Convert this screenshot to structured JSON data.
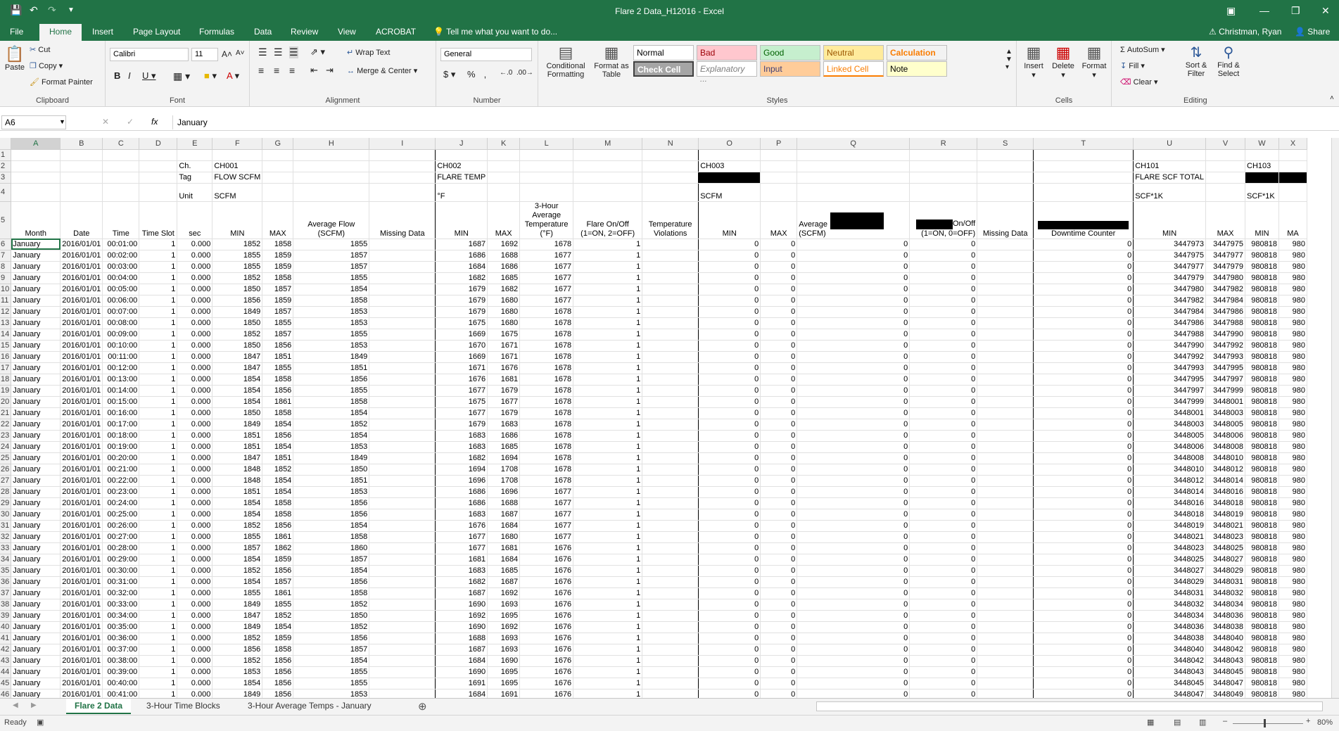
{
  "window": {
    "title": "Flare 2 Data_H12016 - Excel",
    "user": "Christman, Ryan",
    "share_label": "Share",
    "tell_me": "Tell me what you want to do..."
  },
  "tabs": [
    "File",
    "Home",
    "Insert",
    "Page Layout",
    "Formulas",
    "Data",
    "Review",
    "View",
    "ACROBAT"
  ],
  "ribbon": {
    "clipboard": {
      "paste": "Paste",
      "cut": "Cut",
      "copy": "Copy",
      "format_painter": "Format Painter",
      "label": "Clipboard"
    },
    "font": {
      "name": "Calibri",
      "size": "11",
      "label": "Font"
    },
    "alignment": {
      "wrap": "Wrap Text",
      "merge": "Merge & Center",
      "label": "Alignment"
    },
    "number": {
      "format": "General",
      "label": "Number"
    },
    "styles": {
      "conditional": "Conditional Formatting",
      "format_table": "Format as Table",
      "label": "Styles",
      "cells": [
        {
          "text": "Normal",
          "bg": "#ffffff",
          "fg": "#000000"
        },
        {
          "text": "Bad",
          "bg": "#ffc7ce",
          "fg": "#9c0006"
        },
        {
          "text": "Good",
          "bg": "#c6efce",
          "fg": "#006100"
        },
        {
          "text": "Neutral",
          "bg": "#ffeb9c",
          "fg": "#9c5700"
        },
        {
          "text": "Calculation",
          "bg": "#f2f2f2",
          "fg": "#fa7d00"
        },
        {
          "text": "Check Cell",
          "bg": "#a5a5a5",
          "fg": "#ffffff"
        },
        {
          "text": "Explanatory ...",
          "bg": "#ffffff",
          "fg": "#7f7f7f"
        },
        {
          "text": "Input",
          "bg": "#ffcc99",
          "fg": "#3f3f76"
        },
        {
          "text": "Linked Cell",
          "bg": "#ffffff",
          "fg": "#fa7d00"
        },
        {
          "text": "Note",
          "bg": "#ffffcc",
          "fg": "#000000"
        }
      ]
    },
    "cells": {
      "insert": "Insert",
      "delete": "Delete",
      "format": "Format",
      "label": "Cells"
    },
    "editing": {
      "autosum": "AutoSum",
      "fill": "Fill",
      "clear": "Clear",
      "sort": "Sort & Filter",
      "find": "Find & Select",
      "label": "Editing"
    }
  },
  "formula_bar": {
    "name_box": "A6",
    "value": "January"
  },
  "columns": [
    "A",
    "B",
    "C",
    "D",
    "E",
    "F",
    "G",
    "H",
    "I",
    "J",
    "K",
    "L",
    "M",
    "N",
    "O",
    "P",
    "Q",
    "R",
    "S",
    "T",
    "U",
    "V",
    "W",
    "X"
  ],
  "header_rows": {
    "r1": [],
    "r2": {
      "E": "Ch.",
      "F": "CH001",
      "J": "CH002",
      "O": "CH003",
      "U": "CH101",
      "W": "CH103"
    },
    "r3": {
      "E": "Tag",
      "F": "FLOW SCFM",
      "J": "FLARE TEMP",
      "U": "FLARE SCF TOTAL"
    },
    "r4": {
      "E": "Unit",
      "F": "SCFM",
      "J": "°F",
      "O": "SCFM",
      "U": "SCF*1K",
      "W": "SCF*1K"
    },
    "r5": {
      "A": "Month",
      "B": "Date",
      "C": "Time",
      "D": "Time Slot",
      "E": "sec",
      "F": "MIN",
      "G": "MAX",
      "H": "Average Flow (SCFM)",
      "I": "Missing Data",
      "J": "MIN",
      "K": "MAX",
      "L": "3-Hour Average Temperature (°F)",
      "M": "Flare On/Off (1=ON, 2=OFF)",
      "N": "Temperature Violations",
      "O": "MIN",
      "P": "MAX",
      "Q": "(SCFM)",
      "Q_left": "Average",
      "R": "On/Off (1=ON, 0=OFF)",
      "S": "Missing Data",
      "T": "Downtime Counter",
      "U": "MIN",
      "V": "MAX",
      "W": "MIN",
      "X": "MA"
    }
  },
  "data_rows": [
    [
      "January",
      "2016/01/01",
      "00:01:00",
      "1",
      "0.000",
      "1852",
      "1858",
      "1855",
      "",
      "1687",
      "1692",
      "1678",
      "1",
      "",
      "0",
      "0",
      "0",
      "0",
      "",
      "0",
      "3447973",
      "3447975",
      "980818",
      "980"
    ],
    [
      "January",
      "2016/01/01",
      "00:02:00",
      "1",
      "0.000",
      "1855",
      "1859",
      "1857",
      "",
      "1686",
      "1688",
      "1677",
      "1",
      "",
      "0",
      "0",
      "0",
      "0",
      "",
      "0",
      "3447975",
      "3447977",
      "980818",
      "980"
    ],
    [
      "January",
      "2016/01/01",
      "00:03:00",
      "1",
      "0.000",
      "1855",
      "1859",
      "1857",
      "",
      "1684",
      "1686",
      "1677",
      "1",
      "",
      "0",
      "0",
      "0",
      "0",
      "",
      "0",
      "3447977",
      "3447979",
      "980818",
      "980"
    ],
    [
      "January",
      "2016/01/01",
      "00:04:00",
      "1",
      "0.000",
      "1852",
      "1858",
      "1855",
      "",
      "1682",
      "1685",
      "1677",
      "1",
      "",
      "0",
      "0",
      "0",
      "0",
      "",
      "0",
      "3447979",
      "3447980",
      "980818",
      "980"
    ],
    [
      "January",
      "2016/01/01",
      "00:05:00",
      "1",
      "0.000",
      "1850",
      "1857",
      "1854",
      "",
      "1679",
      "1682",
      "1677",
      "1",
      "",
      "0",
      "0",
      "0",
      "0",
      "",
      "0",
      "3447980",
      "3447982",
      "980818",
      "980"
    ],
    [
      "January",
      "2016/01/01",
      "00:06:00",
      "1",
      "0.000",
      "1856",
      "1859",
      "1858",
      "",
      "1679",
      "1680",
      "1677",
      "1",
      "",
      "0",
      "0",
      "0",
      "0",
      "",
      "0",
      "3447982",
      "3447984",
      "980818",
      "980"
    ],
    [
      "January",
      "2016/01/01",
      "00:07:00",
      "1",
      "0.000",
      "1849",
      "1857",
      "1853",
      "",
      "1679",
      "1680",
      "1678",
      "1",
      "",
      "0",
      "0",
      "0",
      "0",
      "",
      "0",
      "3447984",
      "3447986",
      "980818",
      "980"
    ],
    [
      "January",
      "2016/01/01",
      "00:08:00",
      "1",
      "0.000",
      "1850",
      "1855",
      "1853",
      "",
      "1675",
      "1680",
      "1678",
      "1",
      "",
      "0",
      "0",
      "0",
      "0",
      "",
      "0",
      "3447986",
      "3447988",
      "980818",
      "980"
    ],
    [
      "January",
      "2016/01/01",
      "00:09:00",
      "1",
      "0.000",
      "1852",
      "1857",
      "1855",
      "",
      "1669",
      "1675",
      "1678",
      "1",
      "",
      "0",
      "0",
      "0",
      "0",
      "",
      "0",
      "3447988",
      "3447990",
      "980818",
      "980"
    ],
    [
      "January",
      "2016/01/01",
      "00:10:00",
      "1",
      "0.000",
      "1850",
      "1856",
      "1853",
      "",
      "1670",
      "1671",
      "1678",
      "1",
      "",
      "0",
      "0",
      "0",
      "0",
      "",
      "0",
      "3447990",
      "3447992",
      "980818",
      "980"
    ],
    [
      "January",
      "2016/01/01",
      "00:11:00",
      "1",
      "0.000",
      "1847",
      "1851",
      "1849",
      "",
      "1669",
      "1671",
      "1678",
      "1",
      "",
      "0",
      "0",
      "0",
      "0",
      "",
      "0",
      "3447992",
      "3447993",
      "980818",
      "980"
    ],
    [
      "January",
      "2016/01/01",
      "00:12:00",
      "1",
      "0.000",
      "1847",
      "1855",
      "1851",
      "",
      "1671",
      "1676",
      "1678",
      "1",
      "",
      "0",
      "0",
      "0",
      "0",
      "",
      "0",
      "3447993",
      "3447995",
      "980818",
      "980"
    ],
    [
      "January",
      "2016/01/01",
      "00:13:00",
      "1",
      "0.000",
      "1854",
      "1858",
      "1856",
      "",
      "1676",
      "1681",
      "1678",
      "1",
      "",
      "0",
      "0",
      "0",
      "0",
      "",
      "0",
      "3447995",
      "3447997",
      "980818",
      "980"
    ],
    [
      "January",
      "2016/01/01",
      "00:14:00",
      "1",
      "0.000",
      "1854",
      "1856",
      "1855",
      "",
      "1677",
      "1679",
      "1678",
      "1",
      "",
      "0",
      "0",
      "0",
      "0",
      "",
      "0",
      "3447997",
      "3447999",
      "980818",
      "980"
    ],
    [
      "January",
      "2016/01/01",
      "00:15:00",
      "1",
      "0.000",
      "1854",
      "1861",
      "1858",
      "",
      "1675",
      "1677",
      "1678",
      "1",
      "",
      "0",
      "0",
      "0",
      "0",
      "",
      "0",
      "3447999",
      "3448001",
      "980818",
      "980"
    ],
    [
      "January",
      "2016/01/01",
      "00:16:00",
      "1",
      "0.000",
      "1850",
      "1858",
      "1854",
      "",
      "1677",
      "1679",
      "1678",
      "1",
      "",
      "0",
      "0",
      "0",
      "0",
      "",
      "0",
      "3448001",
      "3448003",
      "980818",
      "980"
    ],
    [
      "January",
      "2016/01/01",
      "00:17:00",
      "1",
      "0.000",
      "1849",
      "1854",
      "1852",
      "",
      "1679",
      "1683",
      "1678",
      "1",
      "",
      "0",
      "0",
      "0",
      "0",
      "",
      "0",
      "3448003",
      "3448005",
      "980818",
      "980"
    ],
    [
      "January",
      "2016/01/01",
      "00:18:00",
      "1",
      "0.000",
      "1851",
      "1856",
      "1854",
      "",
      "1683",
      "1686",
      "1678",
      "1",
      "",
      "0",
      "0",
      "0",
      "0",
      "",
      "0",
      "3448005",
      "3448006",
      "980818",
      "980"
    ],
    [
      "January",
      "2016/01/01",
      "00:19:00",
      "1",
      "0.000",
      "1851",
      "1854",
      "1853",
      "",
      "1683",
      "1685",
      "1678",
      "1",
      "",
      "0",
      "0",
      "0",
      "0",
      "",
      "0",
      "3448006",
      "3448008",
      "980818",
      "980"
    ],
    [
      "January",
      "2016/01/01",
      "00:20:00",
      "1",
      "0.000",
      "1847",
      "1851",
      "1849",
      "",
      "1682",
      "1694",
      "1678",
      "1",
      "",
      "0",
      "0",
      "0",
      "0",
      "",
      "0",
      "3448008",
      "3448010",
      "980818",
      "980"
    ],
    [
      "January",
      "2016/01/01",
      "00:21:00",
      "1",
      "0.000",
      "1848",
      "1852",
      "1850",
      "",
      "1694",
      "1708",
      "1678",
      "1",
      "",
      "0",
      "0",
      "0",
      "0",
      "",
      "0",
      "3448010",
      "3448012",
      "980818",
      "980"
    ],
    [
      "January",
      "2016/01/01",
      "00:22:00",
      "1",
      "0.000",
      "1848",
      "1854",
      "1851",
      "",
      "1696",
      "1708",
      "1678",
      "1",
      "",
      "0",
      "0",
      "0",
      "0",
      "",
      "0",
      "3448012",
      "3448014",
      "980818",
      "980"
    ],
    [
      "January",
      "2016/01/01",
      "00:23:00",
      "1",
      "0.000",
      "1851",
      "1854",
      "1853",
      "",
      "1686",
      "1696",
      "1677",
      "1",
      "",
      "0",
      "0",
      "0",
      "0",
      "",
      "0",
      "3448014",
      "3448016",
      "980818",
      "980"
    ],
    [
      "January",
      "2016/01/01",
      "00:24:00",
      "1",
      "0.000",
      "1854",
      "1858",
      "1856",
      "",
      "1686",
      "1688",
      "1677",
      "1",
      "",
      "0",
      "0",
      "0",
      "0",
      "",
      "0",
      "3448016",
      "3448018",
      "980818",
      "980"
    ],
    [
      "January",
      "2016/01/01",
      "00:25:00",
      "1",
      "0.000",
      "1854",
      "1858",
      "1856",
      "",
      "1683",
      "1687",
      "1677",
      "1",
      "",
      "0",
      "0",
      "0",
      "0",
      "",
      "0",
      "3448018",
      "3448019",
      "980818",
      "980"
    ],
    [
      "January",
      "2016/01/01",
      "00:26:00",
      "1",
      "0.000",
      "1852",
      "1856",
      "1854",
      "",
      "1676",
      "1684",
      "1677",
      "1",
      "",
      "0",
      "0",
      "0",
      "0",
      "",
      "0",
      "3448019",
      "3448021",
      "980818",
      "980"
    ],
    [
      "January",
      "2016/01/01",
      "00:27:00",
      "1",
      "0.000",
      "1855",
      "1861",
      "1858",
      "",
      "1677",
      "1680",
      "1677",
      "1",
      "",
      "0",
      "0",
      "0",
      "0",
      "",
      "0",
      "3448021",
      "3448023",
      "980818",
      "980"
    ],
    [
      "January",
      "2016/01/01",
      "00:28:00",
      "1",
      "0.000",
      "1857",
      "1862",
      "1860",
      "",
      "1677",
      "1681",
      "1676",
      "1",
      "",
      "0",
      "0",
      "0",
      "0",
      "",
      "0",
      "3448023",
      "3448025",
      "980818",
      "980"
    ],
    [
      "January",
      "2016/01/01",
      "00:29:00",
      "1",
      "0.000",
      "1854",
      "1859",
      "1857",
      "",
      "1681",
      "1684",
      "1676",
      "1",
      "",
      "0",
      "0",
      "0",
      "0",
      "",
      "0",
      "3448025",
      "3448027",
      "980818",
      "980"
    ],
    [
      "January",
      "2016/01/01",
      "00:30:00",
      "1",
      "0.000",
      "1852",
      "1856",
      "1854",
      "",
      "1683",
      "1685",
      "1676",
      "1",
      "",
      "0",
      "0",
      "0",
      "0",
      "",
      "0",
      "3448027",
      "3448029",
      "980818",
      "980"
    ],
    [
      "January",
      "2016/01/01",
      "00:31:00",
      "1",
      "0.000",
      "1854",
      "1857",
      "1856",
      "",
      "1682",
      "1687",
      "1676",
      "1",
      "",
      "0",
      "0",
      "0",
      "0",
      "",
      "0",
      "3448029",
      "3448031",
      "980818",
      "980"
    ],
    [
      "January",
      "2016/01/01",
      "00:32:00",
      "1",
      "0.000",
      "1855",
      "1861",
      "1858",
      "",
      "1687",
      "1692",
      "1676",
      "1",
      "",
      "0",
      "0",
      "0",
      "0",
      "",
      "0",
      "3448031",
      "3448032",
      "980818",
      "980"
    ],
    [
      "January",
      "2016/01/01",
      "00:33:00",
      "1",
      "0.000",
      "1849",
      "1855",
      "1852",
      "",
      "1690",
      "1693",
      "1676",
      "1",
      "",
      "0",
      "0",
      "0",
      "0",
      "",
      "0",
      "3448032",
      "3448034",
      "980818",
      "980"
    ],
    [
      "January",
      "2016/01/01",
      "00:34:00",
      "1",
      "0.000",
      "1847",
      "1852",
      "1850",
      "",
      "1692",
      "1695",
      "1676",
      "1",
      "",
      "0",
      "0",
      "0",
      "0",
      "",
      "0",
      "3448034",
      "3448036",
      "980818",
      "980"
    ],
    [
      "January",
      "2016/01/01",
      "00:35:00",
      "1",
      "0.000",
      "1849",
      "1854",
      "1852",
      "",
      "1690",
      "1692",
      "1676",
      "1",
      "",
      "0",
      "0",
      "0",
      "0",
      "",
      "0",
      "3448036",
      "3448038",
      "980818",
      "980"
    ],
    [
      "January",
      "2016/01/01",
      "00:36:00",
      "1",
      "0.000",
      "1852",
      "1859",
      "1856",
      "",
      "1688",
      "1693",
      "1676",
      "1",
      "",
      "0",
      "0",
      "0",
      "0",
      "",
      "0",
      "3448038",
      "3448040",
      "980818",
      "980"
    ],
    [
      "January",
      "2016/01/01",
      "00:37:00",
      "1",
      "0.000",
      "1856",
      "1858",
      "1857",
      "",
      "1687",
      "1693",
      "1676",
      "1",
      "",
      "0",
      "0",
      "0",
      "0",
      "",
      "0",
      "3448040",
      "3448042",
      "980818",
      "980"
    ],
    [
      "January",
      "2016/01/01",
      "00:38:00",
      "1",
      "0.000",
      "1852",
      "1856",
      "1854",
      "",
      "1684",
      "1690",
      "1676",
      "1",
      "",
      "0",
      "0",
      "0",
      "0",
      "",
      "0",
      "3448042",
      "3448043",
      "980818",
      "980"
    ],
    [
      "January",
      "2016/01/01",
      "00:39:00",
      "1",
      "0.000",
      "1853",
      "1856",
      "1855",
      "",
      "1690",
      "1695",
      "1676",
      "1",
      "",
      "0",
      "0",
      "0",
      "0",
      "",
      "0",
      "3448043",
      "3448045",
      "980818",
      "980"
    ],
    [
      "January",
      "2016/01/01",
      "00:40:00",
      "1",
      "0.000",
      "1854",
      "1856",
      "1855",
      "",
      "1691",
      "1695",
      "1676",
      "1",
      "",
      "0",
      "0",
      "0",
      "0",
      "",
      "0",
      "3448045",
      "3448047",
      "980818",
      "980"
    ],
    [
      "January",
      "2016/01/01",
      "00:41:00",
      "1",
      "0.000",
      "1849",
      "1856",
      "1853",
      "",
      "1684",
      "1691",
      "1676",
      "1",
      "",
      "0",
      "0",
      "0",
      "0",
      "",
      "0",
      "3448047",
      "3448049",
      "980818",
      "980"
    ]
  ],
  "sheet_tabs": [
    "Flare 2 Data",
    "3-Hour Time Blocks",
    "3-Hour Average Temps - January"
  ],
  "status": {
    "ready": "Ready",
    "zoom": "80%"
  }
}
